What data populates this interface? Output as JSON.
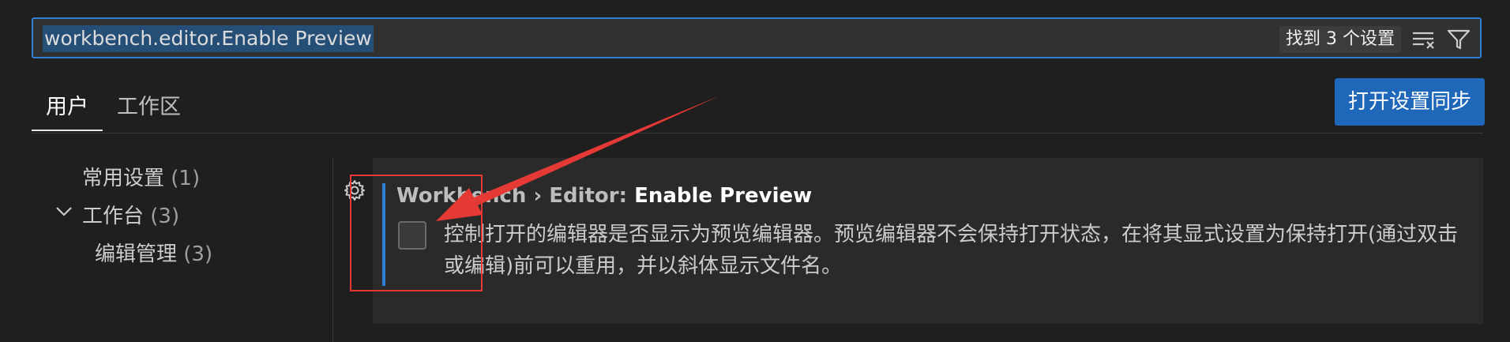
{
  "search": {
    "query": "workbench.editor.Enable Preview",
    "result_count": "找到 3 个设置",
    "clear_icon": "clear-filter-icon",
    "filter_icon": "funnel-icon"
  },
  "tabs": [
    {
      "label": "用户",
      "active": true
    },
    {
      "label": "工作区",
      "active": false
    }
  ],
  "sync_button": "打开设置同步",
  "toc": {
    "items": [
      {
        "label": "常用设置",
        "count": "(1)"
      },
      {
        "label": "工作台",
        "count": "(3)",
        "expanded": true
      },
      {
        "label": "编辑管理",
        "count": "(3)"
      }
    ]
  },
  "setting": {
    "breadcrumb": "Workbench › Editor: ",
    "name": "Enable Preview",
    "checked": false,
    "description": "控制打开的编辑器是否显示为预览编辑器。预览编辑器不会保持打开状态，在将其显式设置为保持打开(通过双击或编辑)前可以重用，并以斜体显示文件名。"
  },
  "colors": {
    "background": "#1f1f1f",
    "accent": "#2f7fd6",
    "sync_button": "#1f67b8",
    "annotation": "#e53935"
  }
}
